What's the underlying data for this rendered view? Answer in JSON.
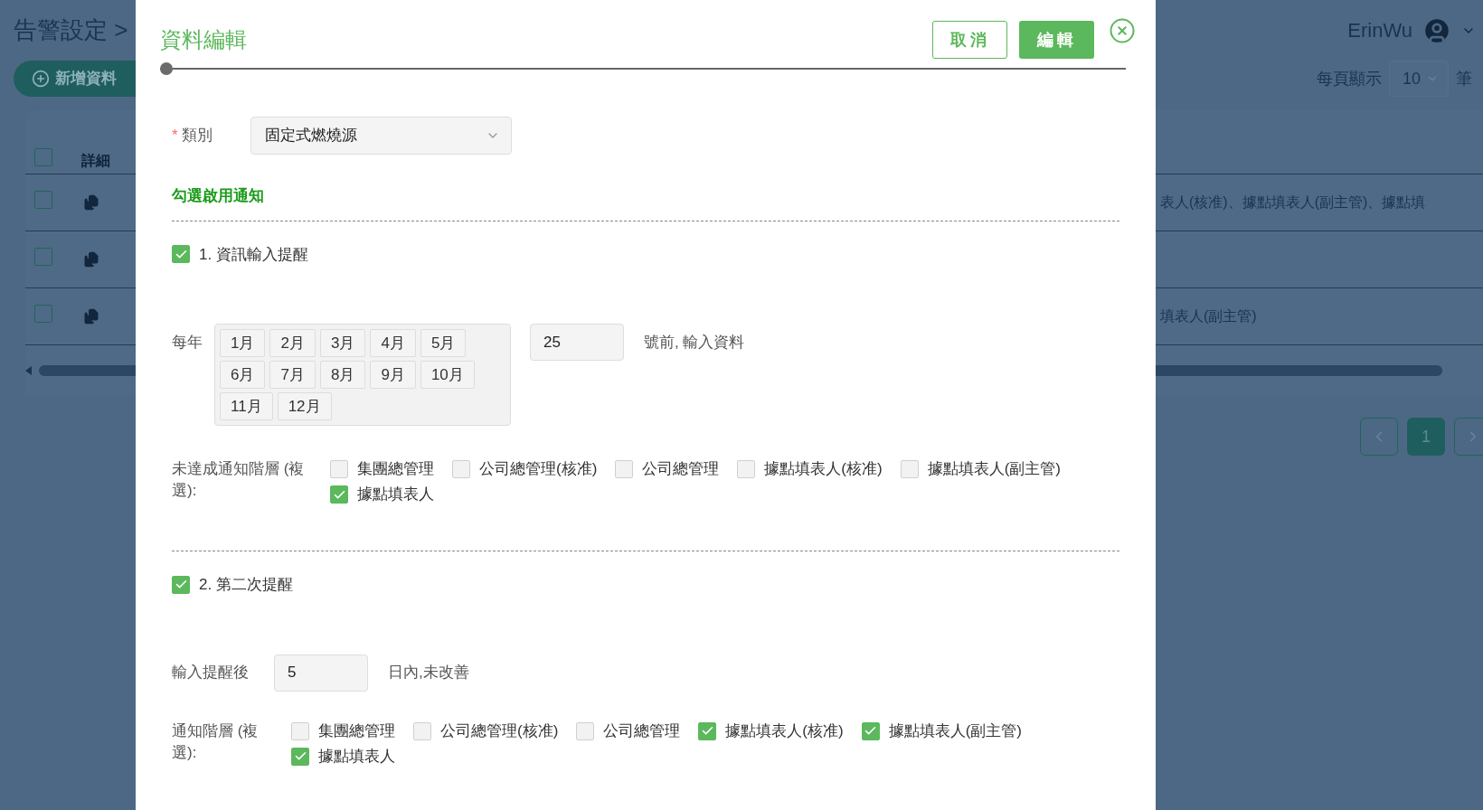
{
  "background": {
    "breadcrumb": "告警設定 >",
    "add_button": "新增資料",
    "user": "ErinWu",
    "page_size": {
      "label": "每頁顯示",
      "value": "10",
      "unit": "筆"
    },
    "table": {
      "header_checked": false,
      "header": "詳細",
      "rows": [
        {
          "checked": false,
          "cell": "表人(核准)、據點填表人(副主管)、據點填"
        },
        {
          "checked": false
        },
        {
          "checked": false,
          "cell": "填表人(副主管)"
        }
      ]
    },
    "pages": [
      {
        "label": "1",
        "selected": true
      }
    ]
  },
  "modal": {
    "title": "資料編輯",
    "buttons": [
      {
        "label": "取消",
        "kind": "outline"
      },
      {
        "label": "編輯",
        "kind": "primary"
      }
    ],
    "slider": {
      "level": 0
    },
    "category": {
      "label": "類別",
      "required_mark": "*",
      "value": "固定式燃燒源"
    },
    "section_title": "勾選啟用通知",
    "reminders": [
      {
        "kind": "monthly",
        "label": "1. 資訊輸入提醒",
        "checked": true,
        "prefix": "每年",
        "months": [
          {
            "label": "1月",
            "selected": false
          },
          {
            "label": "2月",
            "selected": false
          },
          {
            "label": "3月",
            "selected": false
          },
          {
            "label": "4月",
            "selected": false
          },
          {
            "label": "5月",
            "selected": false
          },
          {
            "label": "6月",
            "selected": false
          },
          {
            "label": "7月",
            "selected": false
          },
          {
            "label": "8月",
            "selected": false
          },
          {
            "label": "9月",
            "selected": false
          },
          {
            "label": "10月",
            "selected": false
          },
          {
            "label": "11月",
            "selected": false
          },
          {
            "label": "12月",
            "selected": false
          }
        ],
        "value": "25",
        "suffix": "號前, 輸入資料",
        "levels_label": "未達成通知階層 (複選):",
        "levels": [
          {
            "label": "集團總管理",
            "checked": false
          },
          {
            "label": "公司總管理(核准)",
            "checked": false
          },
          {
            "label": "公司總管理",
            "checked": false
          },
          {
            "label": "據點填表人(核准)",
            "checked": false
          },
          {
            "label": "據點填表人(副主管)",
            "checked": false
          },
          {
            "label": "據點填表人",
            "checked": true
          }
        ]
      },
      {
        "kind": "followup",
        "label": "2. 第二次提醒",
        "checked": true,
        "prefix": "輸入提醒後",
        "value": "5",
        "suffix": "日內,未改善",
        "levels_label": "通知階層 (複選):",
        "levels": [
          {
            "label": "集團總管理",
            "checked": false
          },
          {
            "label": "公司總管理(核准)",
            "checked": false
          },
          {
            "label": "公司總管理",
            "checked": false
          },
          {
            "label": "據點填表人(核准)",
            "checked": true
          },
          {
            "label": "據點填表人(副主管)",
            "checked": true
          },
          {
            "label": "據點填表人",
            "checked": true
          }
        ]
      }
    ]
  }
}
